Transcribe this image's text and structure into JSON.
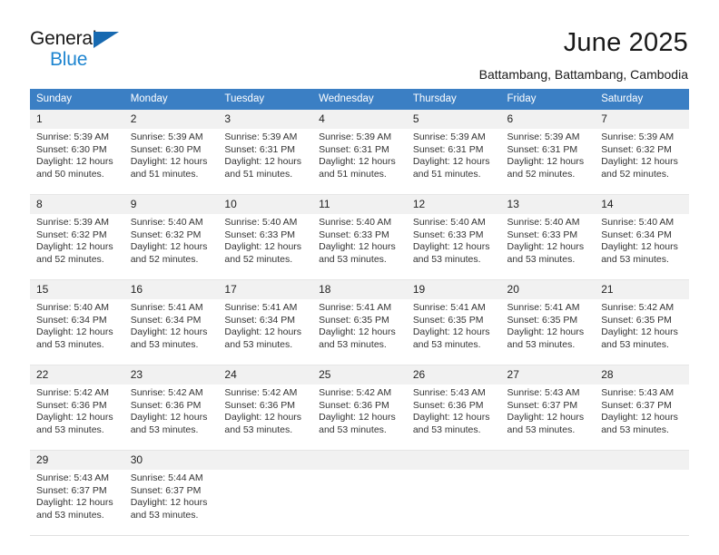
{
  "brand": {
    "name_top": "General",
    "name_bottom": "Blue",
    "flag_icon": "triangle-flag-icon",
    "accent_color": "#1769b0",
    "accent_color_light": "#1e85d0"
  },
  "header": {
    "title": "June 2025",
    "subtitle": "Battambang, Battambang, Cambodia"
  },
  "theme": {
    "header_blue": "#3b7fc4",
    "daynum_band": "#f1f1f1",
    "text": "#222222"
  },
  "calendar": {
    "weekday_headers": [
      "Sunday",
      "Monday",
      "Tuesday",
      "Wednesday",
      "Thursday",
      "Friday",
      "Saturday"
    ],
    "weeks": [
      {
        "days": [
          {
            "num": "1",
            "detail": "Sunrise: 5:39 AM\nSunset: 6:30 PM\nDaylight: 12 hours and 50 minutes."
          },
          {
            "num": "2",
            "detail": "Sunrise: 5:39 AM\nSunset: 6:30 PM\nDaylight: 12 hours and 51 minutes."
          },
          {
            "num": "3",
            "detail": "Sunrise: 5:39 AM\nSunset: 6:31 PM\nDaylight: 12 hours and 51 minutes."
          },
          {
            "num": "4",
            "detail": "Sunrise: 5:39 AM\nSunset: 6:31 PM\nDaylight: 12 hours and 51 minutes."
          },
          {
            "num": "5",
            "detail": "Sunrise: 5:39 AM\nSunset: 6:31 PM\nDaylight: 12 hours and 51 minutes."
          },
          {
            "num": "6",
            "detail": "Sunrise: 5:39 AM\nSunset: 6:31 PM\nDaylight: 12 hours and 52 minutes."
          },
          {
            "num": "7",
            "detail": "Sunrise: 5:39 AM\nSunset: 6:32 PM\nDaylight: 12 hours and 52 minutes."
          }
        ]
      },
      {
        "days": [
          {
            "num": "8",
            "detail": "Sunrise: 5:39 AM\nSunset: 6:32 PM\nDaylight: 12 hours and 52 minutes."
          },
          {
            "num": "9",
            "detail": "Sunrise: 5:40 AM\nSunset: 6:32 PM\nDaylight: 12 hours and 52 minutes."
          },
          {
            "num": "10",
            "detail": "Sunrise: 5:40 AM\nSunset: 6:33 PM\nDaylight: 12 hours and 52 minutes."
          },
          {
            "num": "11",
            "detail": "Sunrise: 5:40 AM\nSunset: 6:33 PM\nDaylight: 12 hours and 53 minutes."
          },
          {
            "num": "12",
            "detail": "Sunrise: 5:40 AM\nSunset: 6:33 PM\nDaylight: 12 hours and 53 minutes."
          },
          {
            "num": "13",
            "detail": "Sunrise: 5:40 AM\nSunset: 6:33 PM\nDaylight: 12 hours and 53 minutes."
          },
          {
            "num": "14",
            "detail": "Sunrise: 5:40 AM\nSunset: 6:34 PM\nDaylight: 12 hours and 53 minutes."
          }
        ]
      },
      {
        "days": [
          {
            "num": "15",
            "detail": "Sunrise: 5:40 AM\nSunset: 6:34 PM\nDaylight: 12 hours and 53 minutes."
          },
          {
            "num": "16",
            "detail": "Sunrise: 5:41 AM\nSunset: 6:34 PM\nDaylight: 12 hours and 53 minutes."
          },
          {
            "num": "17",
            "detail": "Sunrise: 5:41 AM\nSunset: 6:34 PM\nDaylight: 12 hours and 53 minutes."
          },
          {
            "num": "18",
            "detail": "Sunrise: 5:41 AM\nSunset: 6:35 PM\nDaylight: 12 hours and 53 minutes."
          },
          {
            "num": "19",
            "detail": "Sunrise: 5:41 AM\nSunset: 6:35 PM\nDaylight: 12 hours and 53 minutes."
          },
          {
            "num": "20",
            "detail": "Sunrise: 5:41 AM\nSunset: 6:35 PM\nDaylight: 12 hours and 53 minutes."
          },
          {
            "num": "21",
            "detail": "Sunrise: 5:42 AM\nSunset: 6:35 PM\nDaylight: 12 hours and 53 minutes."
          }
        ]
      },
      {
        "days": [
          {
            "num": "22",
            "detail": "Sunrise: 5:42 AM\nSunset: 6:36 PM\nDaylight: 12 hours and 53 minutes."
          },
          {
            "num": "23",
            "detail": "Sunrise: 5:42 AM\nSunset: 6:36 PM\nDaylight: 12 hours and 53 minutes."
          },
          {
            "num": "24",
            "detail": "Sunrise: 5:42 AM\nSunset: 6:36 PM\nDaylight: 12 hours and 53 minutes."
          },
          {
            "num": "25",
            "detail": "Sunrise: 5:42 AM\nSunset: 6:36 PM\nDaylight: 12 hours and 53 minutes."
          },
          {
            "num": "26",
            "detail": "Sunrise: 5:43 AM\nSunset: 6:36 PM\nDaylight: 12 hours and 53 minutes."
          },
          {
            "num": "27",
            "detail": "Sunrise: 5:43 AM\nSunset: 6:37 PM\nDaylight: 12 hours and 53 minutes."
          },
          {
            "num": "28",
            "detail": "Sunrise: 5:43 AM\nSunset: 6:37 PM\nDaylight: 12 hours and 53 minutes."
          }
        ]
      },
      {
        "days": [
          {
            "num": "29",
            "detail": "Sunrise: 5:43 AM\nSunset: 6:37 PM\nDaylight: 12 hours and 53 minutes."
          },
          {
            "num": "30",
            "detail": "Sunrise: 5:44 AM\nSunset: 6:37 PM\nDaylight: 12 hours and 53 minutes."
          },
          {
            "num": "",
            "detail": ""
          },
          {
            "num": "",
            "detail": ""
          },
          {
            "num": "",
            "detail": ""
          },
          {
            "num": "",
            "detail": ""
          },
          {
            "num": "",
            "detail": ""
          }
        ]
      }
    ]
  }
}
